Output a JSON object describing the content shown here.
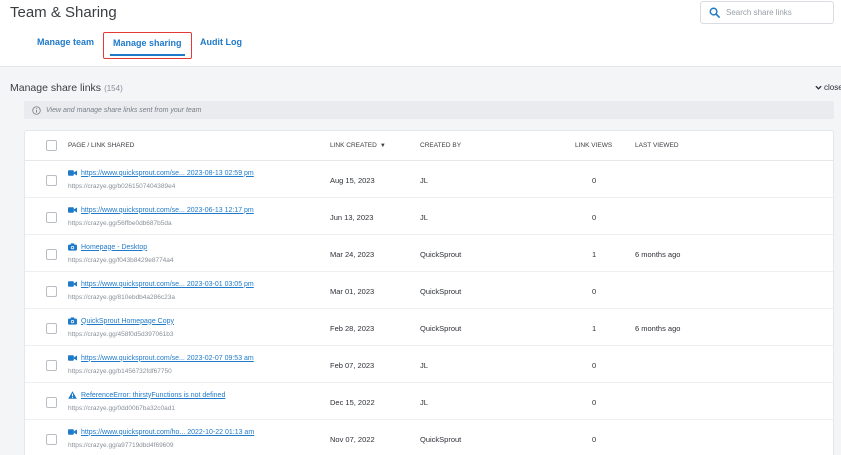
{
  "header": {
    "title": "Team & Sharing",
    "search": {
      "placeholder": "Search share links",
      "icon": "search-icon"
    }
  },
  "tabs": [
    {
      "label": "Manage team",
      "active": false
    },
    {
      "label": "Manage sharing",
      "active": true
    },
    {
      "label": "Audit Log",
      "active": false
    }
  ],
  "section": {
    "title": "Manage share links",
    "count": "(154)",
    "toggle_label": "close",
    "info": "View and manage share links sent from your team"
  },
  "table": {
    "columns": {
      "page": "PAGE / LINK SHARED",
      "created": "LINK CREATED",
      "sort_indicator": "▼",
      "created_by": "CREATED BY",
      "views": "LINK VIEWS",
      "last_viewed": "LAST VIEWED"
    },
    "rows": [
      {
        "icon": "video-icon",
        "title": "https://www.quicksprout.com/se... 2023-08-13 02:59 pm",
        "url": "https://crazye.gg/b0261507404389e4",
        "created": "Aug 15, 2023",
        "created_by": "JL",
        "views": "0",
        "last_viewed": ""
      },
      {
        "icon": "video-icon",
        "title": "https://www.quicksprout.com/se... 2023-06-13 12:17 pm",
        "url": "https://crazye.gg/56ffbe0db687b5da",
        "created": "Jun 13, 2023",
        "created_by": "JL",
        "views": "0",
        "last_viewed": ""
      },
      {
        "icon": "camera-icon",
        "title": "Homepage - Desktop",
        "url": "https://crazye.gg/f043b8429e8774a4",
        "created": "Mar 24, 2023",
        "created_by": "QuickSprout",
        "views": "1",
        "last_viewed": "6 months ago"
      },
      {
        "icon": "video-icon",
        "title": "https://www.quicksprout.com/se... 2023-03-01 03:05 pm",
        "url": "https://crazye.gg/810ebdb4a286c23a",
        "created": "Mar 01, 2023",
        "created_by": "QuickSprout",
        "views": "0",
        "last_viewed": ""
      },
      {
        "icon": "camera-icon",
        "title": "QuickSprout Homepage Copy",
        "url": "https://crazye.gg/458f0d5d397061b3",
        "created": "Feb 28, 2023",
        "created_by": "QuickSprout",
        "views": "1",
        "last_viewed": "6 months ago"
      },
      {
        "icon": "video-icon",
        "title": "https://www.quicksprout.com/se... 2023-02-07 09:53 am",
        "url": "https://crazye.gg/b1456732fdf67750",
        "created": "Feb 07, 2023",
        "created_by": "JL",
        "views": "0",
        "last_viewed": ""
      },
      {
        "icon": "warning-icon",
        "title": "ReferenceError: thirstyFunctions is not defined",
        "url": "https://crazye.gg/0dd00b7ba32c0ad1",
        "created": "Dec 15, 2022",
        "created_by": "JL",
        "views": "0",
        "last_viewed": ""
      },
      {
        "icon": "video-icon",
        "title": "https://www.quicksprout.com/ho... 2022-10-22 01:13 am",
        "url": "https://crazye.gg/a97719dbd4f69609",
        "created": "Nov 07, 2022",
        "created_by": "QuickSprout",
        "views": "0",
        "last_viewed": ""
      }
    ]
  },
  "colors": {
    "accent": "#1f7ac9",
    "highlight": "#e53935",
    "warning": "#1f7ac9"
  }
}
